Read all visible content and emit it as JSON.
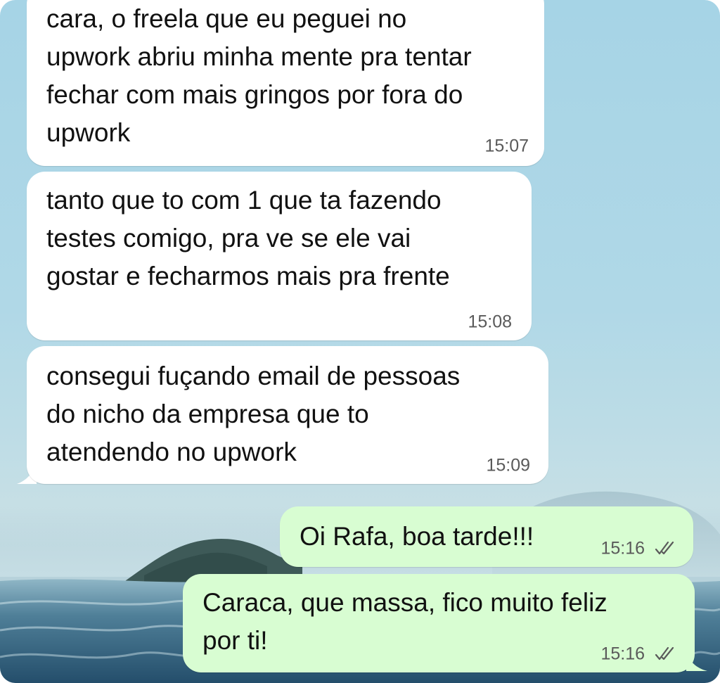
{
  "chat": {
    "messages": [
      {
        "direction": "incoming",
        "text": "cara, o freela que eu peguei no\nupwork abriu minha mente pra tentar\nfechar com mais gringos por fora do\nupwork",
        "time": "15:07"
      },
      {
        "direction": "incoming",
        "text": "tanto que to com 1 que ta fazendo\ntestes comigo, pra ve se ele vai\ngostar e fecharmos mais pra frente",
        "time": "15:08"
      },
      {
        "direction": "incoming",
        "text": "consegui fuçando email de pessoas\ndo nicho da empresa que to\natendendo no upwork",
        "time": "15:09"
      },
      {
        "direction": "outgoing",
        "text": "Oi Rafa, boa tarde!!!",
        "time": "15:16",
        "status_icon": "double-check-icon"
      },
      {
        "direction": "outgoing",
        "text": "Caraca, que massa, fico muito feliz\npor ti!",
        "time": "15:16",
        "status_icon": "double-check-icon"
      }
    ]
  },
  "colors": {
    "incoming_bubble": "#ffffff",
    "outgoing_bubble": "#d8fdd2",
    "message_text": "#111111",
    "timestamp": "#5a5a5a",
    "wallpaper_sky": "#a6d4e6",
    "wallpaper_sea": "#2e5f7e"
  }
}
